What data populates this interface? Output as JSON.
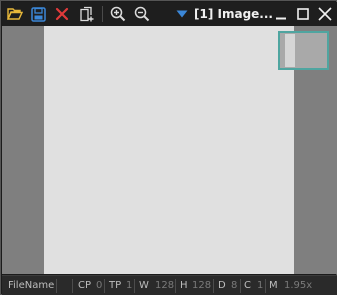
{
  "window": {
    "title": "[1] Image..."
  },
  "toolbar": {
    "icons": [
      "folder-open-icon",
      "save-icon",
      "close-x-icon",
      "duplicate-icon",
      "zoom-in-icon",
      "zoom-out-icon",
      "dropdown-arrow-icon"
    ]
  },
  "window_controls": {
    "minimize": "minimize-icon",
    "maximize": "maximize-icon",
    "close": "close-icon"
  },
  "colors": {
    "toolbar_bg": "#1e1e1e",
    "viewport_bg": "#7f7f7f",
    "image_bg": "#e0e0e0",
    "minimap_border": "#4fa5a0",
    "accent_blue": "#3b87d8",
    "accent_red": "#e03a3a",
    "folder_yellow": "#e8b83a"
  },
  "status": {
    "filename_label": "FileName",
    "cp_label": "CP",
    "cp_value": "0",
    "tp_label": "TP",
    "tp_value": "1",
    "w_label": "W",
    "w_value": "128",
    "h_label": "H",
    "h_value": "128",
    "d_label": "D",
    "d_value": "8",
    "c_label": "C",
    "c_value": "1",
    "m_label": "M",
    "m_value": "1.95x"
  }
}
